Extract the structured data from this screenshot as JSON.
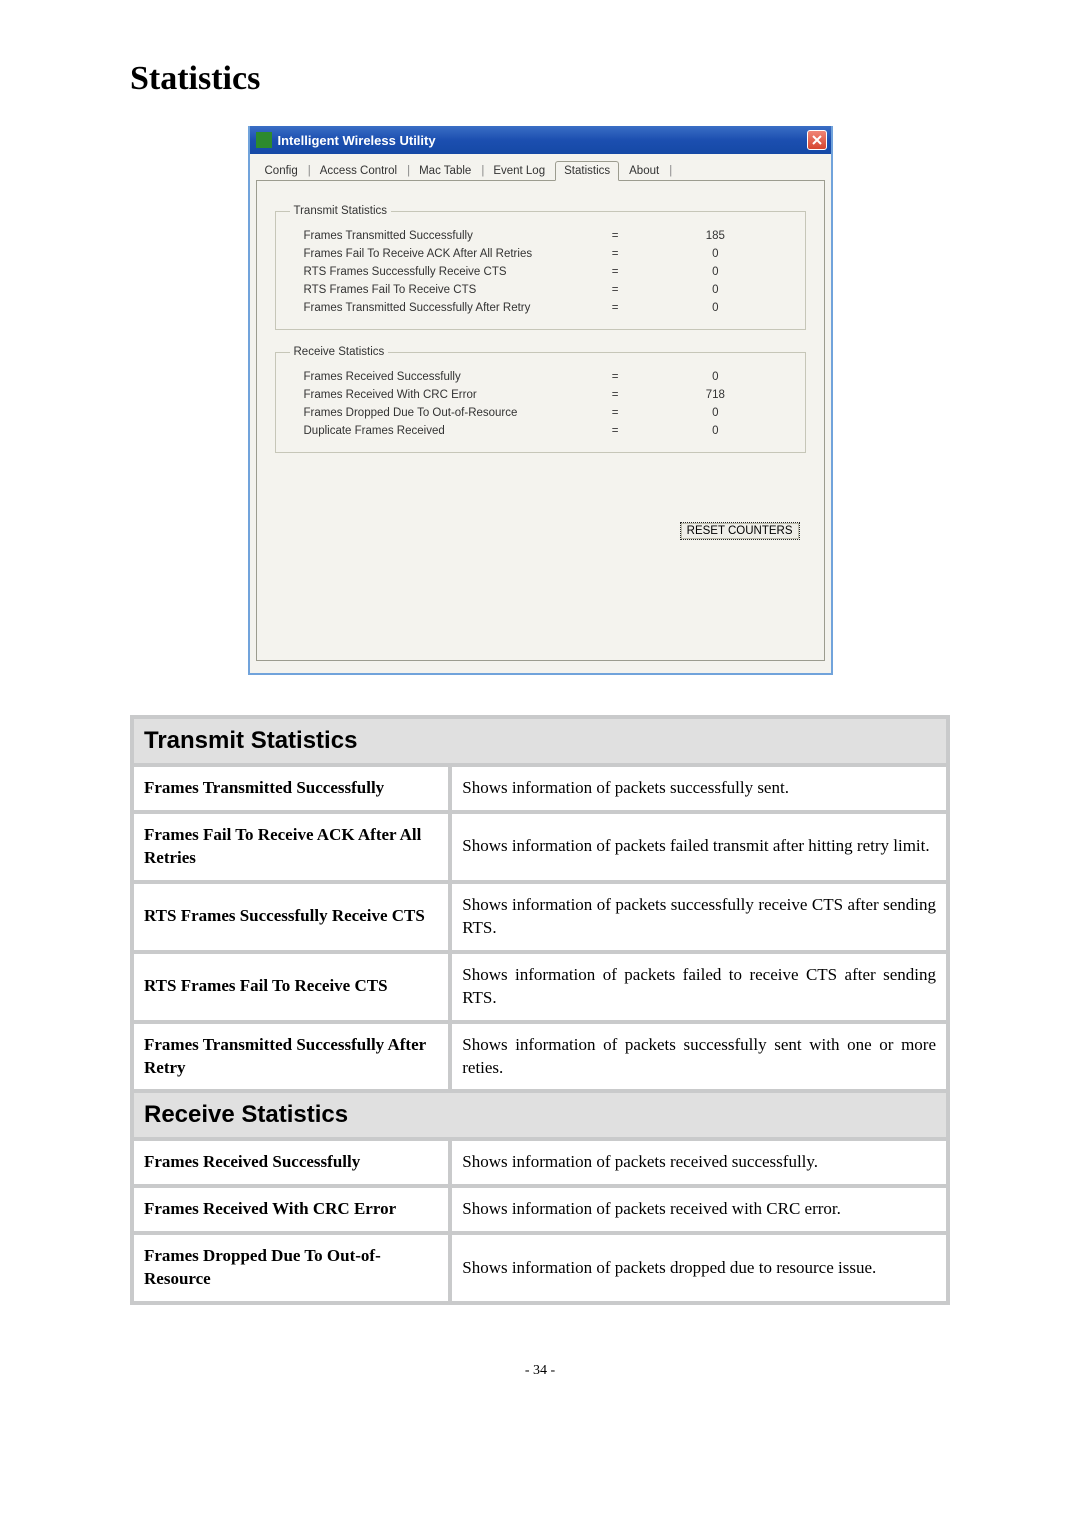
{
  "page": {
    "heading": "Statistics",
    "footer": "- 34 -"
  },
  "dialog": {
    "title": "Intelligent Wireless Utility",
    "tabs": [
      "Config",
      "Access Control",
      "Mac Table",
      "Event Log",
      "Statistics",
      "About"
    ],
    "active_tab": "Statistics",
    "transmit": {
      "legend": "Transmit Statistics",
      "rows": [
        {
          "label": "Frames Transmitted Successfully",
          "value": "185"
        },
        {
          "label": "Frames Fail To Receive ACK After All Retries",
          "value": "0"
        },
        {
          "label": "RTS Frames Successfully Receive CTS",
          "value": "0"
        },
        {
          "label": "RTS Frames Fail To Receive CTS",
          "value": "0"
        },
        {
          "label": "Frames Transmitted Successfully After Retry",
          "value": "0"
        }
      ]
    },
    "receive": {
      "legend": "Receive Statistics",
      "rows": [
        {
          "label": "Frames Received Successfully",
          "value": "0"
        },
        {
          "label": "Frames Received With CRC Error",
          "value": "718"
        },
        {
          "label": "Frames Dropped Due To Out-of-Resource",
          "value": "0"
        },
        {
          "label": "Duplicate Frames Received",
          "value": "0"
        }
      ]
    },
    "reset_button": "RESET COUNTERS"
  },
  "tables": {
    "transmit_header": "Transmit Statistics",
    "transmit_rows": [
      {
        "term": "Frames Transmitted Successfully",
        "desc": "Shows information of packets successfully sent."
      },
      {
        "term": "Frames Fail To Receive ACK After All Retries",
        "desc": "Shows information of packets failed transmit after hitting retry limit.",
        "justify": true
      },
      {
        "term": "RTS Frames Successfully Receive CTS",
        "desc": "Shows information of packets successfully receive CTS after sending RTS.",
        "justify": true
      },
      {
        "term": "RTS Frames Fail To Receive CTS",
        "desc": "Shows information of packets failed to receive CTS after sending RTS.",
        "justify": true
      },
      {
        "term": "Frames Transmitted Successfully After Retry",
        "desc": "Shows information of packets successfully sent with one or more reties.",
        "justify": true
      }
    ],
    "receive_header": "Receive Statistics",
    "receive_rows": [
      {
        "term": "Frames Received Successfully",
        "desc": "Shows information of packets received successfully."
      },
      {
        "term": "Frames Received With CRC Error",
        "desc": "Shows information of packets received with CRC error."
      },
      {
        "term": "Frames Dropped Due To Out-of-Resource",
        "desc": "Shows information of packets dropped due to resource issue."
      }
    ]
  }
}
